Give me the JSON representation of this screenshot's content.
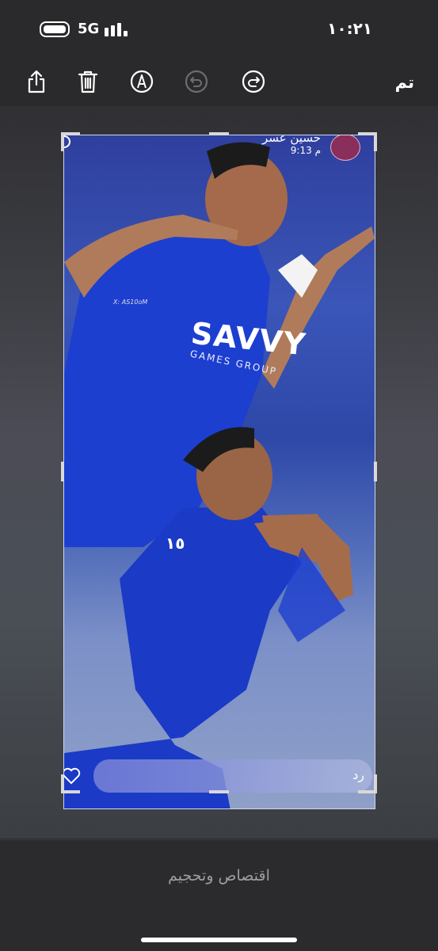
{
  "status": {
    "network": "5G",
    "time": "١٠:٢١"
  },
  "toolbar": {
    "done_label": "تم",
    "icons": [
      "share-icon",
      "trash-icon",
      "markup-icon",
      "undo-icon",
      "redo-icon"
    ]
  },
  "story": {
    "username": "حسين عسر",
    "time": "9:13 م",
    "watermark": "X: AS10oM",
    "sponsor": "SAVVY",
    "sponsor_sub": "GAMES GROUP",
    "shirt_number": "١٥",
    "reply_placeholder": "رد"
  },
  "caption": {
    "label": "اقتصاص وتحجيم"
  },
  "colors": {
    "accent": "#ffffff",
    "background": "#2a2a2c",
    "kit_blue": "#1d3fd0"
  }
}
